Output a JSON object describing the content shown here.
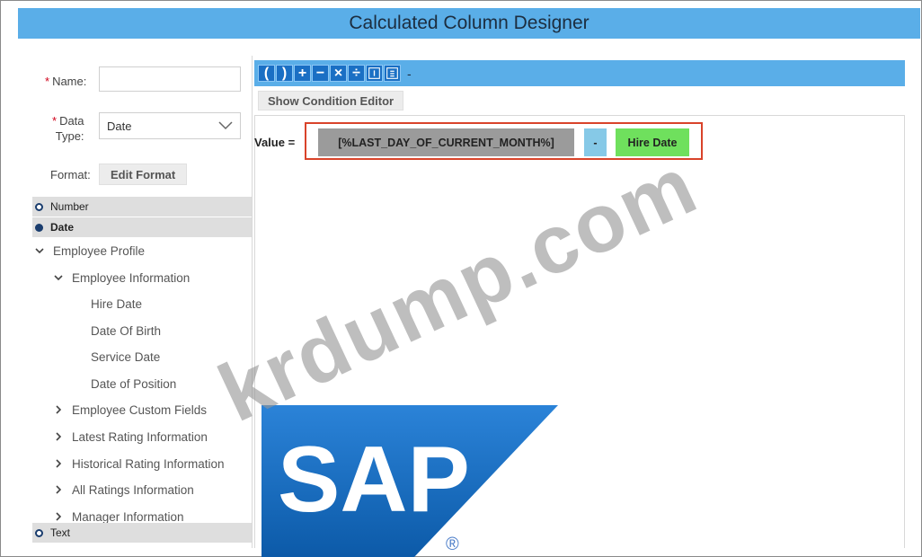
{
  "window": {
    "title": "Calculated Column Designer"
  },
  "form": {
    "name_label": "Name:",
    "name_value": "",
    "data_type_label_line1": "Data",
    "data_type_label_line2": "Type:",
    "data_type_value": "Date",
    "format_label": "Format:",
    "edit_format_button": "Edit Format",
    "required_marker": "*"
  },
  "categories": {
    "number": "Number",
    "date": "Date",
    "text": "Text"
  },
  "tree": {
    "employee_profile": "Employee Profile",
    "employee_information": "Employee Information",
    "hire_date": "Hire Date",
    "date_of_birth": "Date Of Birth",
    "service_date": "Service Date",
    "date_of_position": "Date of Position",
    "employee_custom_fields": "Employee Custom Fields",
    "latest_rating_information": "Latest Rating Information",
    "historical_rating_information": "Historical Rating Information",
    "all_ratings_information": "All Ratings Information",
    "manager_information": "Manager Information"
  },
  "toolbar": {
    "operators": [
      "(",
      ")",
      "+",
      "−",
      "×",
      "÷"
    ],
    "dash": "-"
  },
  "condition_editor_button": "Show Condition Editor",
  "expression": {
    "value_label": "Value =",
    "function_token": "[%LAST_DAY_OF_CURRENT_MONTH%]",
    "operator_token": "-",
    "field_token": "Hire Date"
  },
  "logo": {
    "text": "SAP",
    "registered": "®"
  },
  "watermark": "krdump.com",
  "colors": {
    "title_bar": "#5aaee8",
    "toolbar_button": "#1a6fc4",
    "function_token": "#9b9b9b",
    "operator_token": "#86c9e7",
    "field_token": "#6fe05d",
    "highlight_frame": "#d9432a"
  }
}
